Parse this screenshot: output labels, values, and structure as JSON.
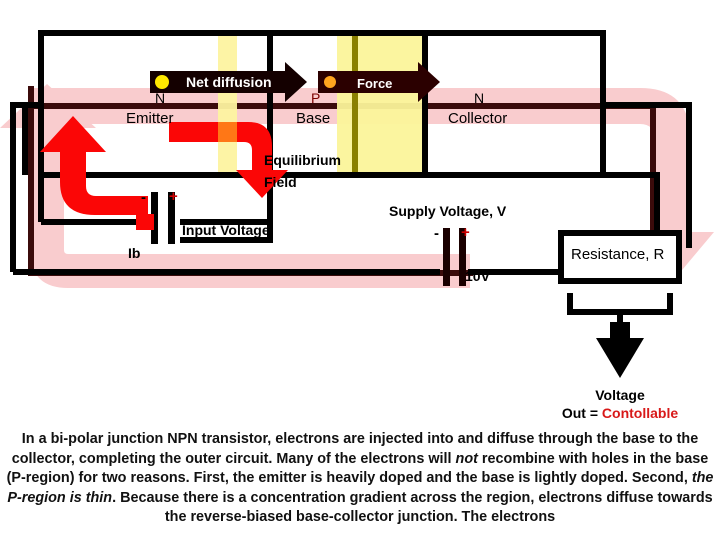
{
  "diagram": {
    "title_semantics": "NPN bipolar junction transistor circuit diagram",
    "regions": [
      {
        "type_label": "N",
        "name_label": "Emitter"
      },
      {
        "type_label": "P",
        "name_label": "Base"
      },
      {
        "type_label": "N",
        "name_label": "Collector"
      }
    ],
    "arrows": {
      "net_diffusion": "Net diffusion",
      "force": "Force"
    },
    "field_label_line1": "Equilibrium",
    "field_label_line2": "Field",
    "input_battery": {
      "current_label": "Ib",
      "name": "Input Voltage",
      "minus": "-",
      "plus": "+"
    },
    "supply_battery": {
      "name": "Supply Voltage, V",
      "value": "10V",
      "minus": "-",
      "plus": "+"
    },
    "resistor": {
      "label": "Resistance, R"
    },
    "output": {
      "line1": "Voltage",
      "line2_prefix": "Out = ",
      "line2_value": "Contollable"
    }
  },
  "body_text": {
    "full": "In a bi-polar junction NPN transistor, electrons are injected into and diffuse through the base to the collector, completing the outer circuit. Many of the electrons will not recombine with holes in the base (P-region) for two reasons. First, the emitter is heavily doped and the base is lightly doped. Second, the P-region is thin. Because there is a concentration gradient across the region, electrons diffuse towards the reverse-biased base-collector junction. The electrons",
    "segments": [
      {
        "text": "In a bi-polar junction NPN transistor, electrons are injected into and diffuse through the base to the collector, completing the outer circuit. Many of the electrons will ",
        "italic": false
      },
      {
        "text": "not",
        "italic": true
      },
      {
        "text": " recombine with holes in the base (P-region) for two reasons. First, the emitter is heavily doped and the base is lightly doped. Second, ",
        "italic": false
      },
      {
        "text": "the P-region is thin",
        "italic": true
      },
      {
        "text": ". Because there is a concentration gradient across the region, electrons diffuse towards the reverse-biased base-collector junction. The electrons",
        "italic": false
      }
    ]
  },
  "colors": {
    "wire_black": "#000000",
    "electron_flow_pink": "#f9ccce",
    "electron_flow_pink_dark": "#3b0b0b",
    "hole_flow_red": "#fb0606",
    "depletion_yellow": "#fdf3a0",
    "depletion_yellow2": "#fbf49a",
    "arrow_dark": "#2b0000",
    "accent_red": "#d81919",
    "dot_yellow": "#ffe800",
    "dot_orange": "#ffa51f"
  }
}
